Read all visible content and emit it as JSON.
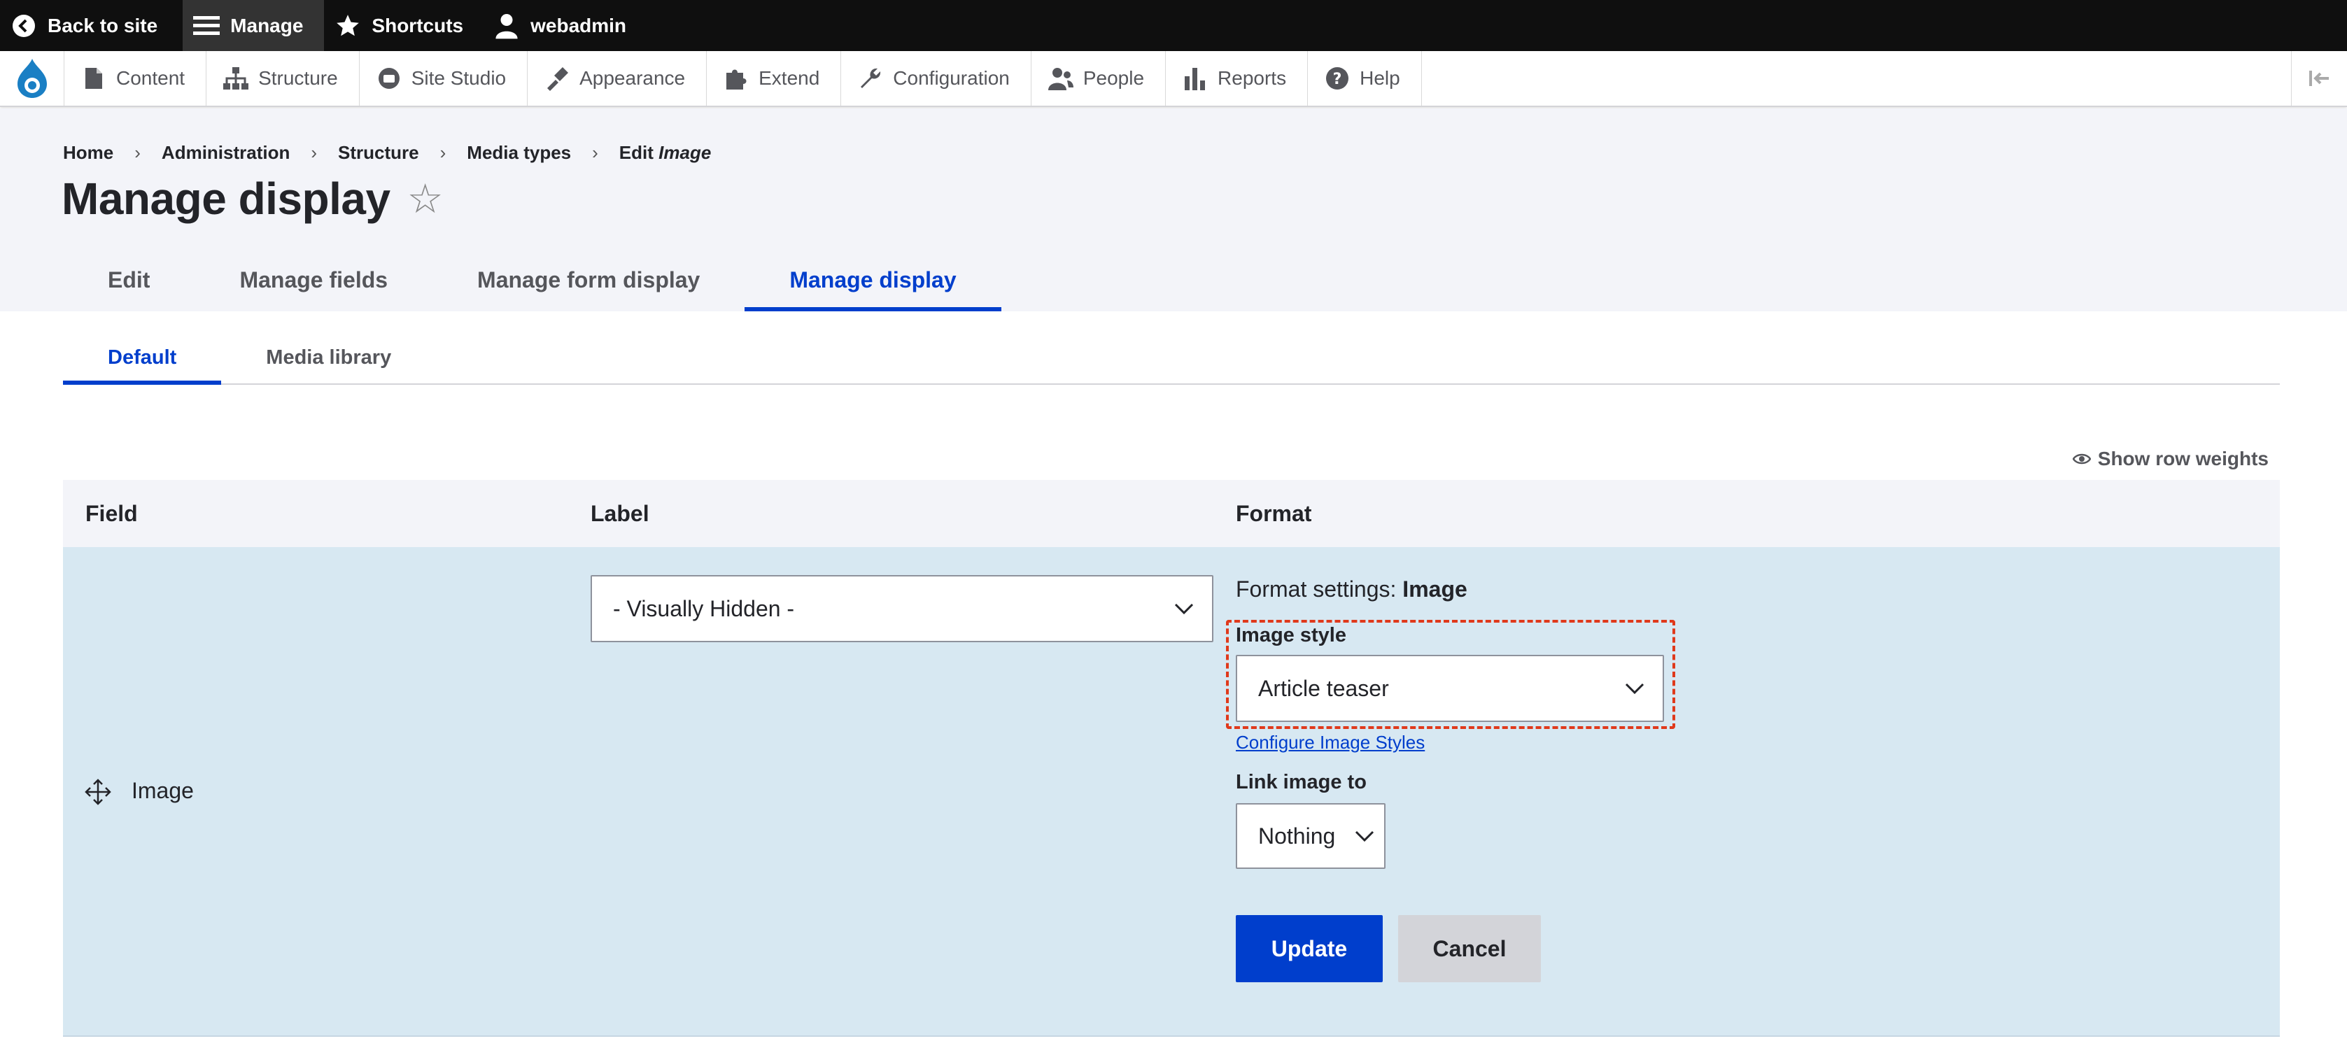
{
  "toolbar": {
    "back_to_site": "Back to site",
    "manage": "Manage",
    "shortcuts": "Shortcuts",
    "user": "webadmin"
  },
  "tray": {
    "items": [
      "Content",
      "Structure",
      "Site Studio",
      "Appearance",
      "Extend",
      "Configuration",
      "People",
      "Reports",
      "Help"
    ]
  },
  "breadcrumb": {
    "items": [
      "Home",
      "Administration",
      "Structure",
      "Media types"
    ],
    "current_prefix": "Edit",
    "current_em": "Image"
  },
  "page": {
    "title": "Manage display",
    "star": "☆"
  },
  "primary_tabs": [
    "Edit",
    "Manage fields",
    "Manage form display",
    "Manage display"
  ],
  "secondary_tabs": [
    "Default",
    "Media library"
  ],
  "row_weights": "Show row weights",
  "table": {
    "headers": {
      "field": "Field",
      "label": "Label",
      "format": "Format"
    },
    "row": {
      "field": "Image",
      "label_select": "- Visually Hidden -",
      "format_settings_prefix": "Format settings:",
      "format_settings_name": "Image",
      "image_style_label": "Image style",
      "image_style_value": "Article teaser",
      "configure_link": "Configure Image Styles",
      "link_image_label": "Link image to",
      "link_image_value": "Nothing",
      "update": "Update",
      "cancel": "Cancel"
    }
  },
  "colors": {
    "accent": "#003ecc",
    "highlight": "#e0391b",
    "row_bg": "#d7e8f2"
  }
}
